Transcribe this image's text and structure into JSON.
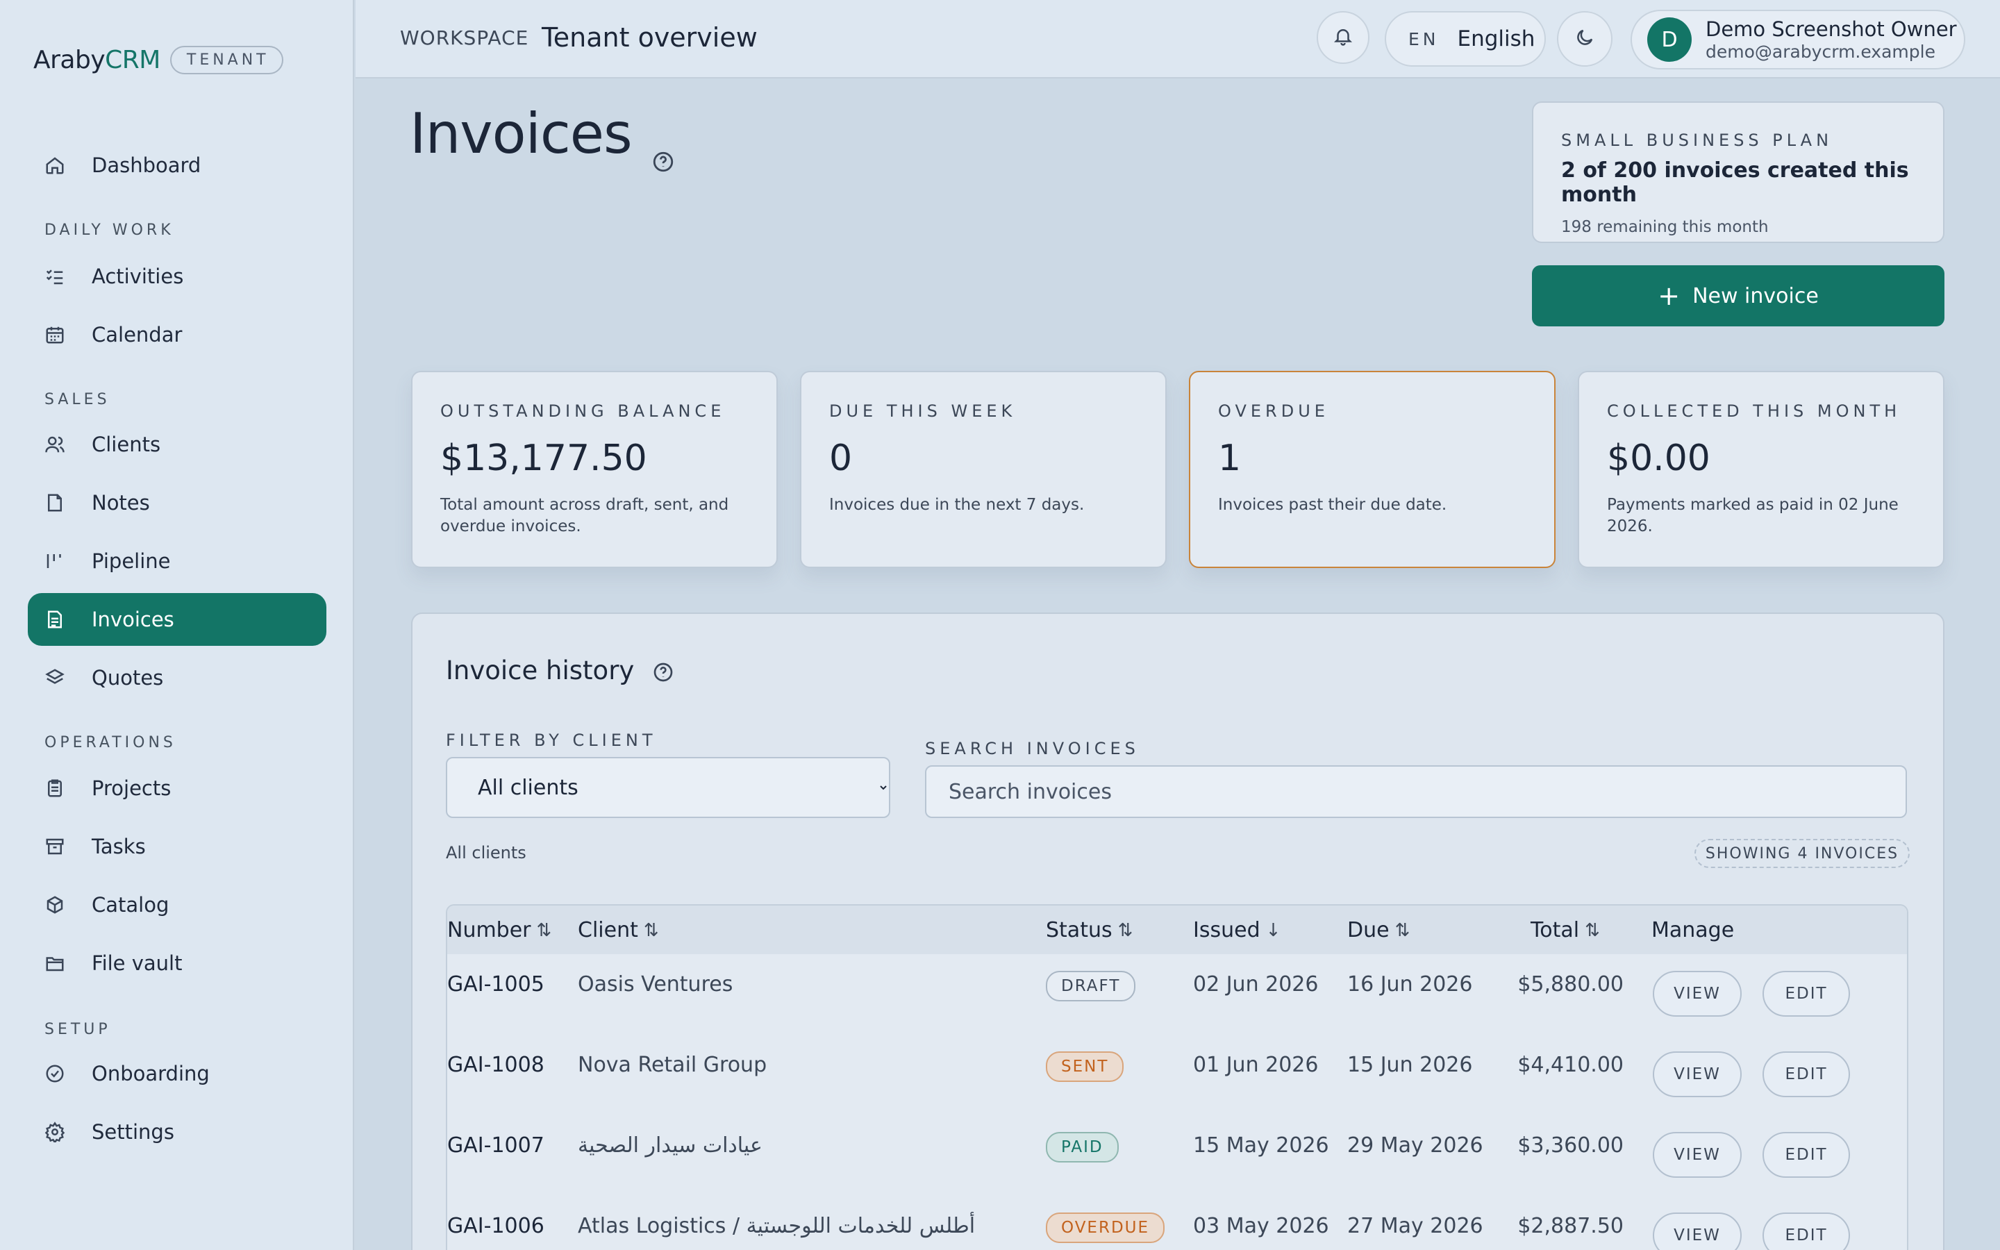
{
  "brand": {
    "name_part1": "Araby",
    "name_part2": "CRM",
    "tag": "TENANT"
  },
  "sidebar": {
    "dashboard": "Dashboard",
    "section_daily": "DAILY WORK",
    "activities": "Activities",
    "calendar": "Calendar",
    "section_sales": "SALES",
    "clients": "Clients",
    "notes": "Notes",
    "pipeline": "Pipeline",
    "invoices": "Invoices",
    "quotes": "Quotes",
    "section_operations": "OPERATIONS",
    "projects": "Projects",
    "tasks": "Tasks",
    "catalog": "Catalog",
    "file_vault": "File vault",
    "section_setup": "SETUP",
    "onboarding": "Onboarding",
    "settings": "Settings",
    "active_item": "invoices"
  },
  "topbar": {
    "workspace": "WORKSPACE",
    "title": "Tenant overview",
    "lang_code": "EN",
    "lang_name": "English",
    "user_initial": "D",
    "user_name": "Demo Screenshot Owner",
    "user_email": "demo@arabycrm.example"
  },
  "page": {
    "title": "Invoices",
    "plan_label": "SMALL BUSINESS PLAN",
    "plan_count": "2 of 200 invoices created this month",
    "plan_remaining": "198 remaining this month",
    "new_button": "New invoice"
  },
  "stats": [
    {
      "label": "OUTSTANDING BALANCE",
      "value": "$13,177.50",
      "desc": "Total amount across draft, sent, and overdue invoices."
    },
    {
      "label": "DUE THIS WEEK",
      "value": "0",
      "desc": "Invoices due in the next 7 days."
    },
    {
      "label": "OVERDUE",
      "value": "1",
      "desc": "Invoices past their due date."
    },
    {
      "label": "COLLECTED THIS MONTH",
      "value": "$0.00",
      "desc": "Payments marked as paid in 02 June 2026."
    }
  ],
  "history": {
    "title": "Invoice history",
    "filter_label": "FILTER BY CLIENT",
    "filter_value": "All clients",
    "search_label": "SEARCH INVOICES",
    "search_placeholder": "Search invoices",
    "filter_note": "All clients",
    "count": "SHOWING 4 INVOICES",
    "columns": {
      "number": "Number",
      "client": "Client",
      "status": "Status",
      "issued": "Issued",
      "due": "Due",
      "total": "Total",
      "manage": "Manage"
    },
    "view_label": "VIEW",
    "edit_label": "EDIT",
    "rows": [
      {
        "number": "GAI-1005",
        "client": "Oasis Ventures",
        "status": "DRAFT",
        "issued": "02 Jun 2026",
        "due": "16 Jun 2026",
        "total": "$5,880.00"
      },
      {
        "number": "GAI-1008",
        "client": "Nova Retail Group",
        "status": "SENT",
        "issued": "01 Jun 2026",
        "due": "15 Jun 2026",
        "total": "$4,410.00"
      },
      {
        "number": "GAI-1007",
        "client": "عيادات سيدار الصحية",
        "status": "PAID",
        "issued": "15 May 2026",
        "due": "29 May 2026",
        "total": "$3,360.00"
      },
      {
        "number": "GAI-1006",
        "client": "Atlas Logistics / أطلس للخدمات اللوجستية",
        "status": "OVERDUE",
        "issued": "03 May 2026",
        "due": "27 May 2026",
        "total": "$2,887.50"
      }
    ]
  },
  "colors": {
    "accent": "#137566",
    "warning": "#c9843a",
    "background": "#ccd9e5"
  }
}
